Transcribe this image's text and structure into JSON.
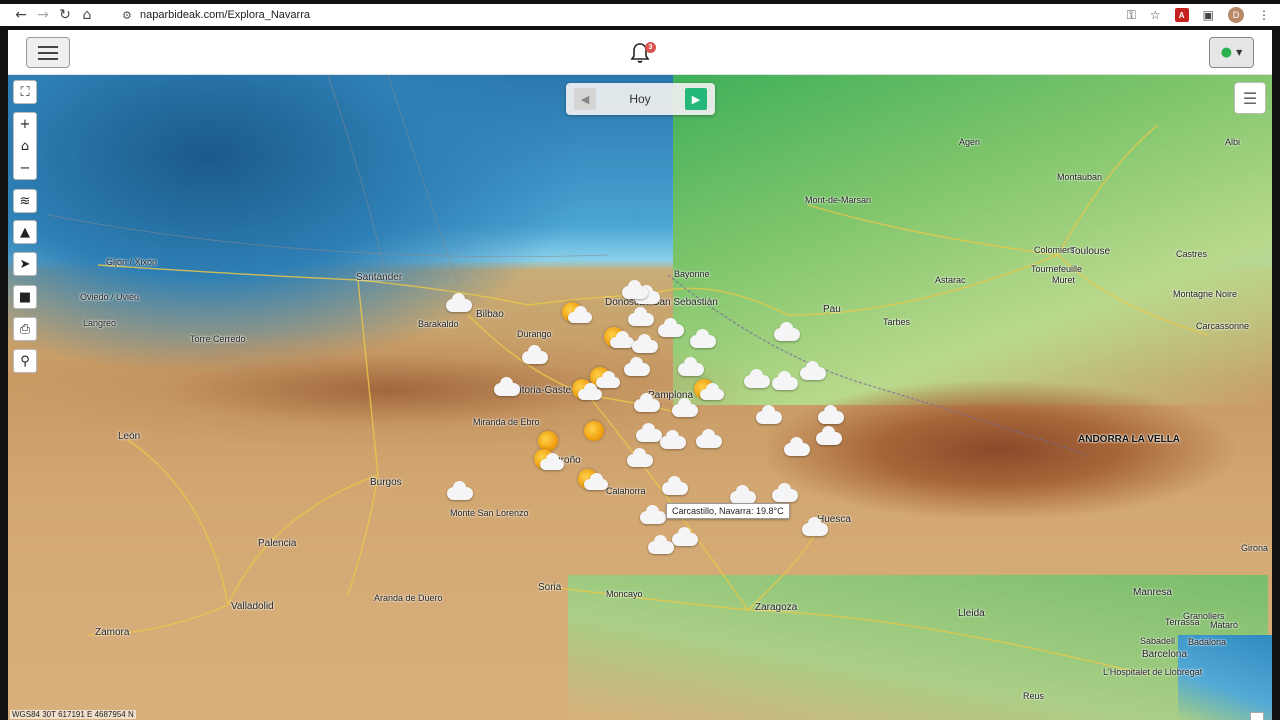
{
  "browser": {
    "url": "naparbideak.com/Explora_Navarra",
    "avatar_letter": "D"
  },
  "header": {
    "notification_count": "3"
  },
  "map": {
    "day_label": "Hoy",
    "tooltip": "Carcastillo, Navarra: 19.8°C",
    "coords": "WGS84 30T 617191 E 4687954 N",
    "cities": [
      {
        "name": "Gijón / Xixón"
      },
      {
        "name": "Oviedo / Uviéu"
      },
      {
        "name": "Santander"
      },
      {
        "name": "Barakaldo"
      },
      {
        "name": "Bilbao"
      },
      {
        "name": "Donostia / San Sebastián"
      },
      {
        "name": "Bayonne"
      },
      {
        "name": "Pau"
      },
      {
        "name": "Tarbes"
      },
      {
        "name": "Toulouse"
      },
      {
        "name": "Mont-de-Marsan"
      },
      {
        "name": "Montauban"
      },
      {
        "name": "Castres"
      },
      {
        "name": "Carcassonne"
      },
      {
        "name": "Albi"
      },
      {
        "name": "Agen"
      },
      {
        "name": "Colomiers"
      },
      {
        "name": "Muret"
      },
      {
        "name": "Tournefeuille"
      },
      {
        "name": "Pamplona"
      },
      {
        "name": "Vitoria-Gasteiz"
      },
      {
        "name": "Durango"
      },
      {
        "name": "Miranda de Ebro"
      },
      {
        "name": "Logroño"
      },
      {
        "name": "Calahorra"
      },
      {
        "name": "León"
      },
      {
        "name": "Burgos"
      },
      {
        "name": "Palencia"
      },
      {
        "name": "Valladolid"
      },
      {
        "name": "Zamora"
      },
      {
        "name": "Soria"
      },
      {
        "name": "Aranda de Duero"
      },
      {
        "name": "Moncayo"
      },
      {
        "name": "Zaragoza"
      },
      {
        "name": "Huesca"
      },
      {
        "name": "Lleida"
      },
      {
        "name": "Manresa"
      },
      {
        "name": "Terrassa"
      },
      {
        "name": "Sabadell"
      },
      {
        "name": "Badalona"
      },
      {
        "name": "Barcelona"
      },
      {
        "name": "Mataró"
      },
      {
        "name": "L'Hospitalet de Llobregat"
      },
      {
        "name": "Granollers"
      },
      {
        "name": "Reus"
      },
      {
        "name": "Girona"
      },
      {
        "name": "Torre Cerredo"
      },
      {
        "name": "Langreo"
      },
      {
        "name": "Monte San Lorenzo"
      },
      {
        "name": "ANDORRA LA VELLA"
      },
      {
        "name": "Montagne Noire"
      },
      {
        "name": "Astarac"
      }
    ],
    "weather": [
      {
        "type": "cloud"
      },
      {
        "type": "cloud"
      },
      {
        "type": "sunny"
      },
      {
        "type": "cloud"
      },
      {
        "type": "sunny"
      },
      {
        "type": "cloud"
      },
      {
        "type": "cloud"
      },
      {
        "type": "cloud"
      },
      {
        "type": "cloud"
      },
      {
        "type": "sunny"
      },
      {
        "type": "cloud"
      },
      {
        "type": "cloud"
      },
      {
        "type": "cloud"
      },
      {
        "type": "sunny"
      },
      {
        "type": "sunny"
      },
      {
        "type": "cloud"
      },
      {
        "type": "cloud"
      },
      {
        "type": "cloud"
      },
      {
        "type": "cloud"
      },
      {
        "type": "cloud"
      },
      {
        "type": "cloud"
      },
      {
        "type": "cloud"
      },
      {
        "type": "sun"
      },
      {
        "type": "sun"
      },
      {
        "type": "cloud"
      },
      {
        "type": "cloud"
      },
      {
        "type": "cloud"
      },
      {
        "type": "cloud"
      },
      {
        "type": "cloud"
      },
      {
        "type": "sunny"
      },
      {
        "type": "sunny"
      },
      {
        "type": "cloud"
      },
      {
        "type": "cloud"
      },
      {
        "type": "cloud"
      },
      {
        "type": "cloud"
      },
      {
        "type": "cloud"
      },
      {
        "type": "cloud"
      },
      {
        "type": "cloud"
      },
      {
        "type": "cloud"
      },
      {
        "type": "cloud"
      },
      {
        "type": "cloud"
      },
      {
        "type": "cloud"
      }
    ]
  }
}
